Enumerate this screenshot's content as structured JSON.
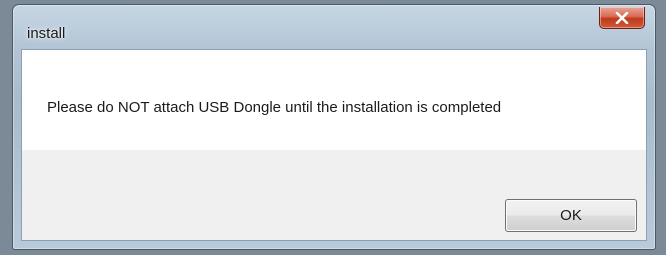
{
  "window": {
    "title": "install",
    "close_icon": "close-x-icon"
  },
  "dialog": {
    "message": "Please do NOT attach USB Dongle until the installation is completed",
    "ok_label": "OK"
  },
  "colors": {
    "close_button": "#c2381c",
    "button_bar": "#f0f0f0"
  }
}
